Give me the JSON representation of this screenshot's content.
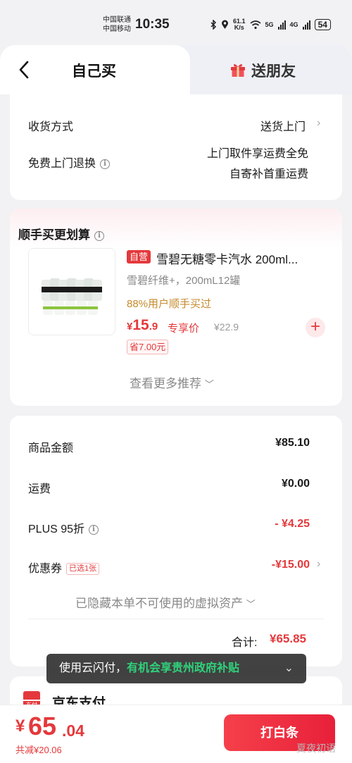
{
  "status_bar": {
    "carrier1": "中国联通",
    "carrier2": "中国移动",
    "time": "10:35",
    "speed_value": "61.1",
    "speed_unit": "K/s",
    "net1": "5G",
    "net2": "4G",
    "battery": "54"
  },
  "tabs": {
    "self_buy": "自己买",
    "send_friend": "送朋友"
  },
  "delivery": {
    "method_label": "收货方式",
    "method_value": "送货上门",
    "return_label": "免费上门退换",
    "return_line1": "上门取件享运费全免",
    "return_line2": "自寄补首重运费"
  },
  "recommend": {
    "title": "顺手买更划算",
    "self_tag": "自营",
    "product_name": "雪碧无糖零卡汽水 200ml...",
    "spec": "雪碧纤维+，200mL12罐",
    "promo": "88%用户顺手买过",
    "price_symbol": "¥",
    "price_int": "15",
    "price_dec": ".9",
    "price_label": "专享价",
    "price_old": "¥22.9",
    "save": "省7.00元",
    "more": "查看更多推荐"
  },
  "summary": {
    "goods_label": "商品金额",
    "goods_value": "¥85.10",
    "shipping_label": "运费",
    "shipping_value": "¥0.00",
    "plus_label": "PLUS 95折",
    "plus_value": "- ¥4.25",
    "coupon_label": "优惠券",
    "coupon_tag": "已选1张",
    "coupon_value": "-¥15.00",
    "hidden_note": "已隐藏本单不可使用的虚拟资产",
    "total_label": "合计:",
    "total_value": "¥65.85"
  },
  "toast": {
    "prefix": "使用云闪付，",
    "highlight": "有机会享贵州政府补贴"
  },
  "payment": {
    "jd_icon_text": "东付",
    "method": "京东支付"
  },
  "bottom": {
    "symbol": "¥",
    "int": "65",
    "dec": ".04",
    "saved": "共减¥20.06",
    "pay_button": "打白条",
    "watermark": "夏夜初语"
  },
  "colors": {
    "accent_red": "#e4393c",
    "promo_gold": "#c78a2c",
    "toast_green": "#2fd27a"
  }
}
